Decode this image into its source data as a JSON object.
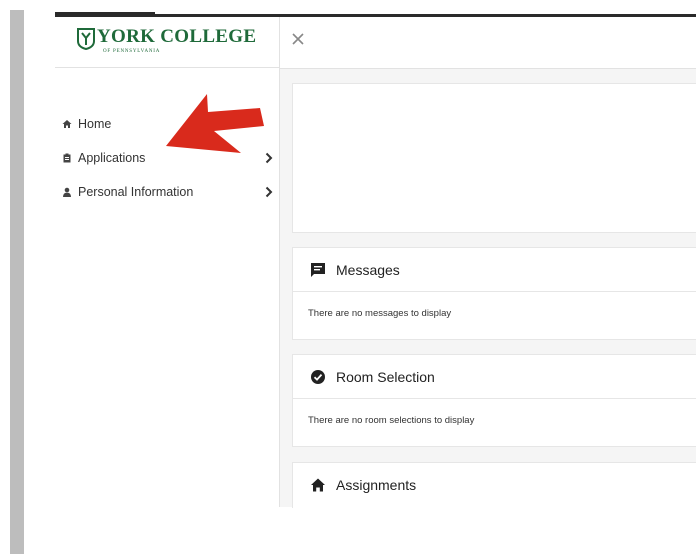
{
  "logo": {
    "text": "YORK COLLEGE",
    "subtext": "OF PENNSYLVANIA"
  },
  "nav": {
    "items": [
      {
        "label": "Home",
        "icon": "home-icon"
      },
      {
        "label": "Applications",
        "icon": "clipboard-icon",
        "chevron": true
      },
      {
        "label": "Personal Information",
        "icon": "user-icon",
        "chevron": true
      }
    ]
  },
  "cards": {
    "messages": {
      "title": "Messages",
      "empty": "There are no messages to display"
    },
    "room_selection": {
      "title": "Room Selection",
      "empty": "There are no room selections to display"
    },
    "assignments": {
      "title": "Assignments"
    }
  },
  "colors": {
    "brand_green": "#1f6a3a",
    "annotation_red": "#d92a1c"
  }
}
